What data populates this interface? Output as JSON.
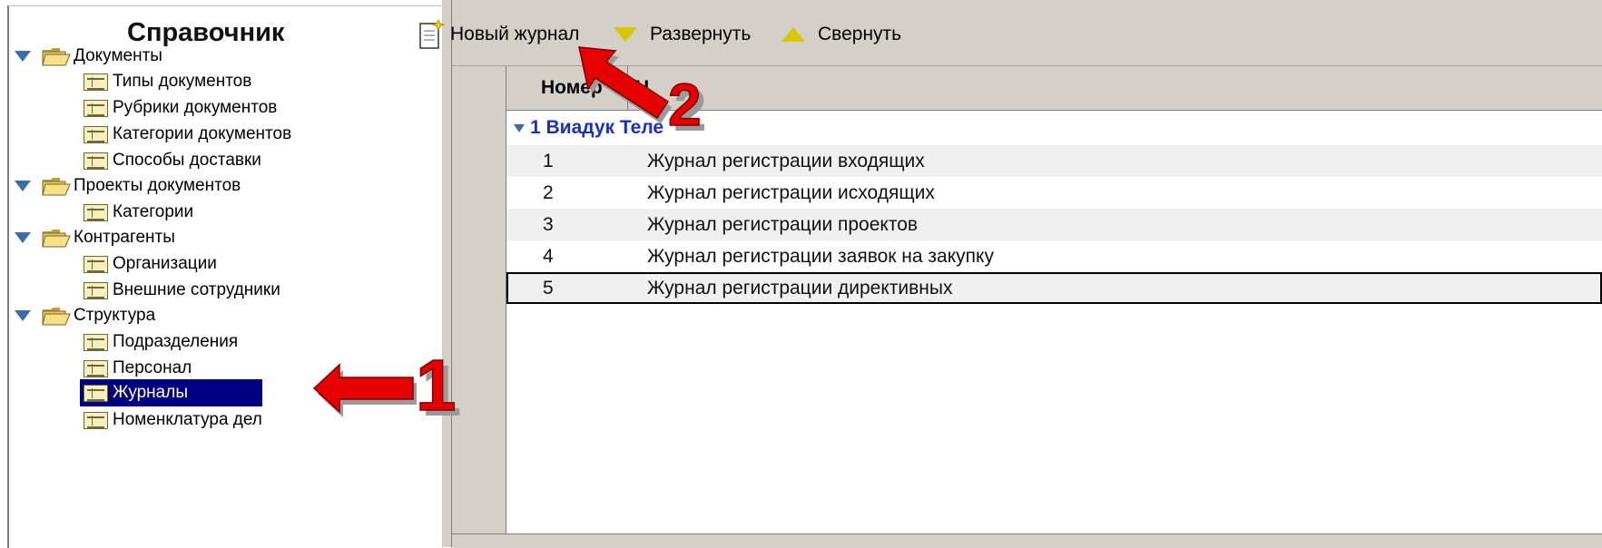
{
  "tree": {
    "title": "Справочник",
    "items": [
      {
        "label": "Документы",
        "type": "folder"
      },
      {
        "label": "Типы документов",
        "type": "leaf"
      },
      {
        "label": "Рубрики документов",
        "type": "leaf"
      },
      {
        "label": "Категории документов",
        "type": "leaf"
      },
      {
        "label": "Способы доставки",
        "type": "leaf"
      },
      {
        "label": "Проекты документов",
        "type": "folder"
      },
      {
        "label": "Категории",
        "type": "leaf"
      },
      {
        "label": "Контрагенты",
        "type": "folder"
      },
      {
        "label": "Организации",
        "type": "leaf"
      },
      {
        "label": "Внешние сотрудники",
        "type": "leaf"
      },
      {
        "label": "Структура",
        "type": "folder"
      },
      {
        "label": "Подразделения",
        "type": "leaf"
      },
      {
        "label": "Персонал",
        "type": "leaf"
      },
      {
        "label": "Журналы",
        "type": "leaf",
        "selected": true
      },
      {
        "label": "Номенклатура дел",
        "type": "leaf"
      }
    ]
  },
  "toolbar": {
    "new_journal": "Новый журнал",
    "expand": "Развернуть",
    "collapse": "Свернуть"
  },
  "grid": {
    "columns": [
      "Номер",
      "Н"
    ],
    "group": "1 Виадук Теле",
    "rows": [
      {
        "num": "1",
        "name": "Журнал регистрации входящих"
      },
      {
        "num": "2",
        "name": "Журнал регистрации исходящих"
      },
      {
        "num": "3",
        "name": "Журнал регистрации проектов"
      },
      {
        "num": "4",
        "name": "Журнал регистрации заявок на закупку"
      },
      {
        "num": "5",
        "name": "Журнал регистрации директивных"
      }
    ]
  },
  "annotations": {
    "arrow1": "1",
    "arrow2": "2"
  },
  "colors": {
    "selection": "#000080",
    "group_text": "#1a2ecc",
    "annotation": "#e60000",
    "panel": "#d4d0c8"
  }
}
